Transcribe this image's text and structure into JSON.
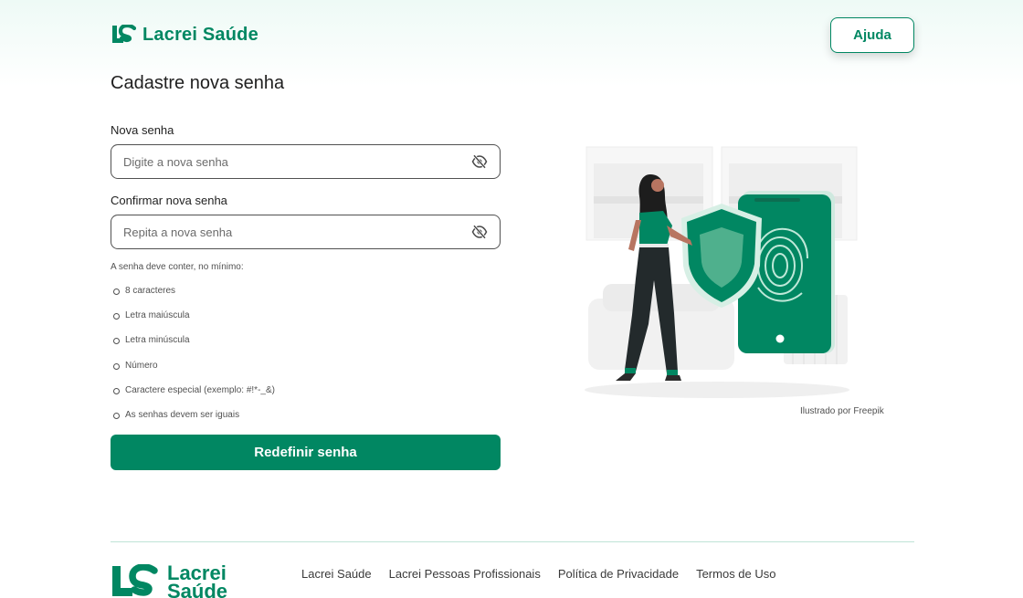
{
  "header": {
    "brand": "Lacrei Saúde",
    "help_label": "Ajuda"
  },
  "form": {
    "title": "Cadastre nova senha",
    "new_password": {
      "label": "Nova senha",
      "placeholder": "Digite a nova senha",
      "value": ""
    },
    "confirm_password": {
      "label": "Confirmar nova senha",
      "placeholder": "Repita a nova senha",
      "value": ""
    },
    "requirements_intro": "A senha deve conter, no mínimo:",
    "requirements": [
      "8 caracteres",
      "Letra maiúscula",
      "Letra minúscula",
      "Número",
      "Caractere especial  (exemplo: #!*-_&)",
      "As senhas devem ser iguais"
    ],
    "submit_label": "Redefinir senha"
  },
  "illustration": {
    "credit": "Ilustrado por Freepik"
  },
  "footer": {
    "brand_line1": "Lacrei",
    "brand_line2": "Saúde",
    "links": [
      "Lacrei Saúde",
      "Lacrei Pessoas Profissionais",
      "Política de Privacidade",
      "Termos de Uso"
    ]
  },
  "colors": {
    "brand": "#018762",
    "text": "#1f1f1f",
    "muted": "#515151",
    "divider": "#bfe3d6"
  }
}
